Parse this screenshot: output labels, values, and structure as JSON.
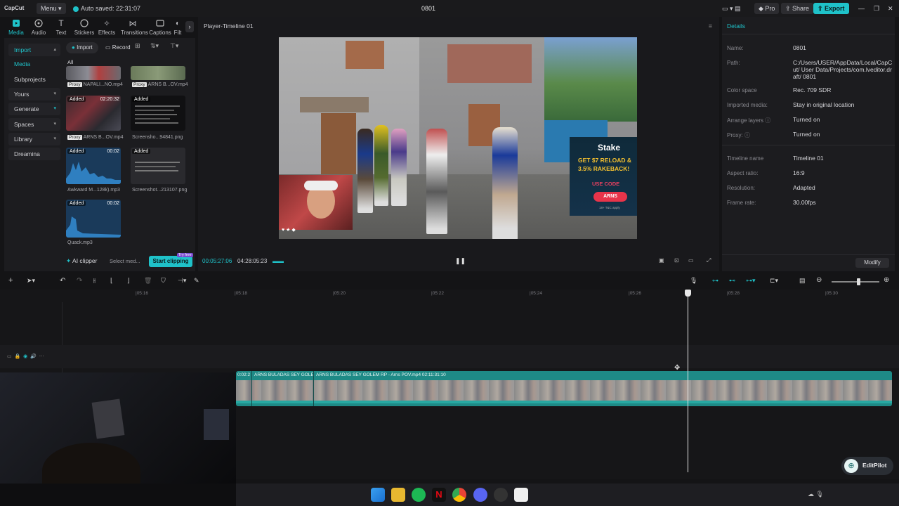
{
  "titlebar": {
    "app_name": "CapCut",
    "menu_label": "Menu",
    "autosave": "Auto saved: 22:31:07",
    "project_title": "0801",
    "pro_label": "Pro",
    "share_label": "Share",
    "export_label": "Export"
  },
  "tools": [
    {
      "label": "Media",
      "icon": "media-icon"
    },
    {
      "label": "Audio",
      "icon": "audio-icon"
    },
    {
      "label": "Text",
      "icon": "text-icon"
    },
    {
      "label": "Stickers",
      "icon": "stickers-icon"
    },
    {
      "label": "Effects",
      "icon": "effects-icon"
    },
    {
      "label": "Transitions",
      "icon": "transitions-icon"
    },
    {
      "label": "Captions",
      "icon": "captions-icon"
    },
    {
      "label": "Filt",
      "icon": "filters-icon"
    }
  ],
  "sidebar": {
    "items": [
      {
        "label": "Import"
      },
      {
        "label": "Media"
      },
      {
        "label": "Subprojects"
      },
      {
        "label": "Yours"
      },
      {
        "label": "Generate"
      },
      {
        "label": "Spaces"
      },
      {
        "label": "Library"
      },
      {
        "label": "Dreamina"
      }
    ]
  },
  "media": {
    "import_label": "Import",
    "record_label": "Record",
    "filter_all": "All",
    "items": [
      {
        "name": "NAPALI...NO.mp4",
        "proxy": "Proxy",
        "added": "",
        "duration": ""
      },
      {
        "name": "ARNS B...OV.mp4",
        "proxy": "Proxy",
        "added": "",
        "duration": ""
      },
      {
        "name": "ARNS B...OV.mp4",
        "proxy": "Proxy",
        "added": "Added",
        "duration": "02:20:32"
      },
      {
        "name": "Screensho...94841.png",
        "proxy": "",
        "added": "Added",
        "duration": ""
      },
      {
        "name": "Awkward M...128k).mp3",
        "proxy": "",
        "added": "Added",
        "duration": "00:02"
      },
      {
        "name": "Screenshot...213107.png",
        "proxy": "",
        "added": "Added",
        "duration": ""
      },
      {
        "name": "Quack.mp3",
        "proxy": "",
        "added": "Added",
        "duration": "00:02"
      }
    ],
    "ai_clipper": "AI clipper",
    "select_media": "Select med...",
    "start_clipping": "Start clipping",
    "try_free": "Try free"
  },
  "player": {
    "title": "Player-Timeline 01",
    "current_time": "00:05:27:06",
    "total_time": "04:28:05:23",
    "overlay": {
      "stake": "Stake",
      "reload": "GET $7 RELOAD &",
      "rakeback": "3.5% RAKEBACK!",
      "use_code": "USE CODE",
      "code": "ARNS",
      "fine": "18+ T&C apply"
    }
  },
  "details": {
    "title": "Details",
    "rows": [
      {
        "label": "Name:",
        "value": "0801"
      },
      {
        "label": "Path:",
        "value": "C:/Users/USER/AppData/Local/CapCut/ User Data/Projects/com.lveditor.draft/ 0801"
      },
      {
        "label": "Color space",
        "value": "Rec. 709 SDR"
      },
      {
        "label": "Imported media:",
        "value": "Stay in original location"
      },
      {
        "label": "Arrange layers",
        "value": "Turned on"
      },
      {
        "label": "Proxy:",
        "value": "Turned on"
      },
      {
        "label": "Timeline name",
        "value": "Timeline 01"
      },
      {
        "label": "Aspect ratio:",
        "value": "16:9"
      },
      {
        "label": "Resolution:",
        "value": "Adapted"
      },
      {
        "label": "Frame rate:",
        "value": "30.00fps"
      }
    ],
    "modify_label": "Modify"
  },
  "timeline": {
    "ruler": [
      "|05:16",
      "|05:18",
      "|05:20",
      "|05:22",
      "|05:24",
      "|05:26",
      "|05:28",
      "|05:30"
    ],
    "clips": [
      {
        "label": "0:02:2"
      },
      {
        "label": "ARNS BULADAS SEY GOLEI"
      },
      {
        "label": "ARNS BULADAS SEY GOLEM RP - Arns POV.mp4   02:11:31:10"
      }
    ],
    "editpilot": "EditPilot"
  },
  "colors": {
    "accent": "#1fc2c9",
    "clip": "#1e8a86",
    "panel": "#1c1c1f"
  }
}
